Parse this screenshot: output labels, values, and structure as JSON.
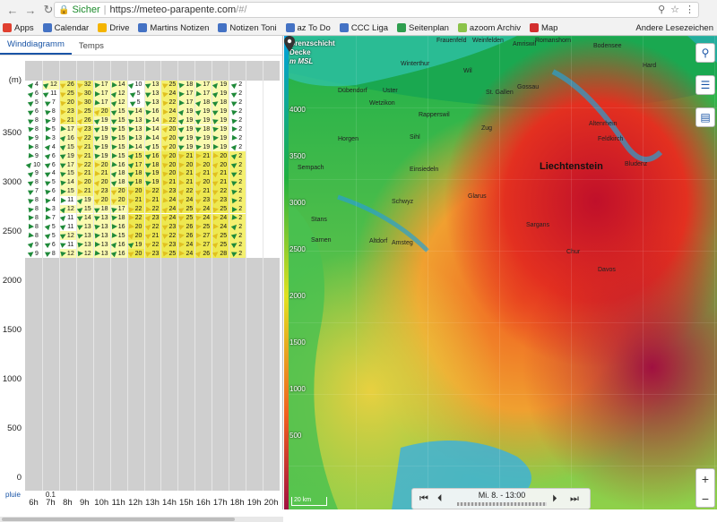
{
  "browser": {
    "secure_label": "Sicher",
    "url_host": "https://meteo-parapente.com",
    "url_path": "/#/",
    "bookmarks": [
      {
        "label": "Apps",
        "color": "#e04030"
      },
      {
        "label": "Calendar",
        "color": "#4472c4"
      },
      {
        "label": "Drive",
        "color": "#f4b400"
      },
      {
        "label": "Martins Notizen",
        "color": "#4472c4"
      },
      {
        "label": "Notizen Toni",
        "color": "#4472c4"
      },
      {
        "label": "az To Do",
        "color": "#4472c4"
      },
      {
        "label": "CCC Liga",
        "color": "#4472c4"
      },
      {
        "label": "Seitenplan",
        "color": "#2e9e4f"
      },
      {
        "label": "azoom Archiv",
        "color": "#8bc34a"
      },
      {
        "label": "Map",
        "color": "#d32f2f"
      }
    ],
    "other_bookmarks": "Andere Lesezeichen"
  },
  "tabs": [
    {
      "label": "Winddiagramm",
      "active": true
    },
    {
      "label": "Temps",
      "active": false
    }
  ],
  "diagram": {
    "y_unit": "(m)",
    "y_ticks": [
      "3500",
      "3000",
      "2500",
      "2000",
      "1500",
      "1000",
      "500",
      "0"
    ],
    "hours": [
      "6h",
      "7h",
      "8h",
      "9h",
      "10h",
      "11h",
      "12h",
      "13h",
      "14h",
      "15h",
      "16h",
      "17h",
      "18h",
      "19h",
      "20h"
    ],
    "rain_label": "pluie",
    "rain_values": [
      "",
      "0.1",
      "",
      "",
      "",
      "",
      "",
      "",
      "",
      "",
      "",
      "",
      "",
      "",
      ""
    ],
    "rows": [
      [
        "4",
        "12",
        "26",
        "32",
        "17",
        "14",
        "10",
        "13",
        "25",
        "18",
        "17",
        "19",
        "2",
        "",
        ""
      ],
      [
        "6",
        "11",
        "25",
        "30",
        "17",
        "12",
        "5",
        "13",
        "24",
        "17",
        "17",
        "19",
        "2",
        "",
        ""
      ],
      [
        "5",
        "7",
        "20",
        "30",
        "17",
        "12",
        "5",
        "13",
        "22",
        "17",
        "18",
        "18",
        "2",
        "",
        ""
      ],
      [
        "6",
        "8",
        "23",
        "25",
        "20",
        "15",
        "14",
        "16",
        "24",
        "19",
        "19",
        "19",
        "2",
        "",
        ""
      ],
      [
        "8",
        "9",
        "21",
        "26",
        "19",
        "15",
        "13",
        "14",
        "22",
        "19",
        "19",
        "19",
        "2",
        "",
        ""
      ],
      [
        "8",
        "5",
        "17",
        "23",
        "19",
        "15",
        "13",
        "14",
        "20",
        "19",
        "18",
        "19",
        "2",
        "",
        ""
      ],
      [
        "9",
        "3",
        "16",
        "22",
        "19",
        "15",
        "13",
        "14",
        "20",
        "19",
        "19",
        "19",
        "2",
        "",
        ""
      ],
      [
        "8",
        "4",
        "15",
        "21",
        "19",
        "15",
        "14",
        "15",
        "20",
        "19",
        "19",
        "19",
        "2",
        "",
        ""
      ],
      [
        "9",
        "6",
        "19",
        "21",
        "19",
        "15",
        "15",
        "16",
        "20",
        "21",
        "21",
        "20",
        "2",
        "",
        ""
      ],
      [
        "10",
        "6",
        "17",
        "22",
        "20",
        "16",
        "17",
        "18",
        "20",
        "20",
        "20",
        "20",
        "2",
        "",
        ""
      ],
      [
        "9",
        "4",
        "15",
        "21",
        "21",
        "18",
        "18",
        "19",
        "20",
        "21",
        "21",
        "21",
        "2",
        "",
        ""
      ],
      [
        "8",
        "5",
        "14",
        "20",
        "20",
        "18",
        "18",
        "19",
        "21",
        "21",
        "20",
        "21",
        "2",
        "",
        ""
      ],
      [
        "7",
        "6",
        "15",
        "21",
        "23",
        "20",
        "20",
        "22",
        "23",
        "22",
        "21",
        "22",
        "2",
        "",
        ""
      ],
      [
        "8",
        "4",
        "11",
        "19",
        "20",
        "20",
        "21",
        "21",
        "24",
        "24",
        "23",
        "23",
        "2",
        "",
        ""
      ],
      [
        "8",
        "3",
        "12",
        "15",
        "18",
        "17",
        "22",
        "22",
        "24",
        "25",
        "24",
        "25",
        "2",
        "",
        ""
      ],
      [
        "8",
        "7",
        "11",
        "14",
        "13",
        "18",
        "22",
        "23",
        "24",
        "25",
        "24",
        "24",
        "2",
        "",
        ""
      ],
      [
        "8",
        "5",
        "11",
        "13",
        "13",
        "16",
        "20",
        "22",
        "23",
        "26",
        "25",
        "24",
        "2",
        "",
        ""
      ],
      [
        "8",
        "5",
        "12",
        "13",
        "13",
        "15",
        "20",
        "21",
        "22",
        "26",
        "27",
        "25",
        "2",
        "",
        ""
      ],
      [
        "9",
        "6",
        "11",
        "13",
        "13",
        "16",
        "19",
        "22",
        "23",
        "24",
        "27",
        "25",
        "2",
        "",
        ""
      ],
      [
        "9",
        "8",
        "12",
        "12",
        "13",
        "16",
        "20",
        "23",
        "25",
        "24",
        "26",
        "28",
        "2",
        "",
        ""
      ]
    ]
  },
  "map": {
    "layer_title": "Grenzschicht",
    "layer_sub": "Decke",
    "layer_unit": "m MSL",
    "legend_ticks": [
      "4000",
      "3500",
      "3000",
      "2500",
      "2000",
      "1500",
      "1000",
      "500"
    ],
    "scale": "20 km",
    "region_label": "Liechtenstein",
    "places": [
      "Frauenfeld",
      "Weinfelden",
      "Amriswil",
      "Romanshorn",
      "Bodensee",
      "Winterthur",
      "Wil",
      "Gossau",
      "St. Gallen",
      "Dübendorf",
      "Uster",
      "Wetzikon",
      "Rapperswil",
      "Horgen",
      "Zug",
      "Sihl",
      "Einsiedeln",
      "Glarus",
      "Schwyz",
      "Altdorf",
      "Sargans",
      "Chur",
      "Davos",
      "Sempach",
      "Sarnen",
      "Stans",
      "Amsteg",
      "Altenrhein",
      "Feldkirch",
      "Bludenz",
      "Hard"
    ],
    "time_label": "Mi. 8. - 13:00"
  },
  "colors": {
    "accent": "#1a55a6",
    "secure": "#1a8a2a"
  }
}
